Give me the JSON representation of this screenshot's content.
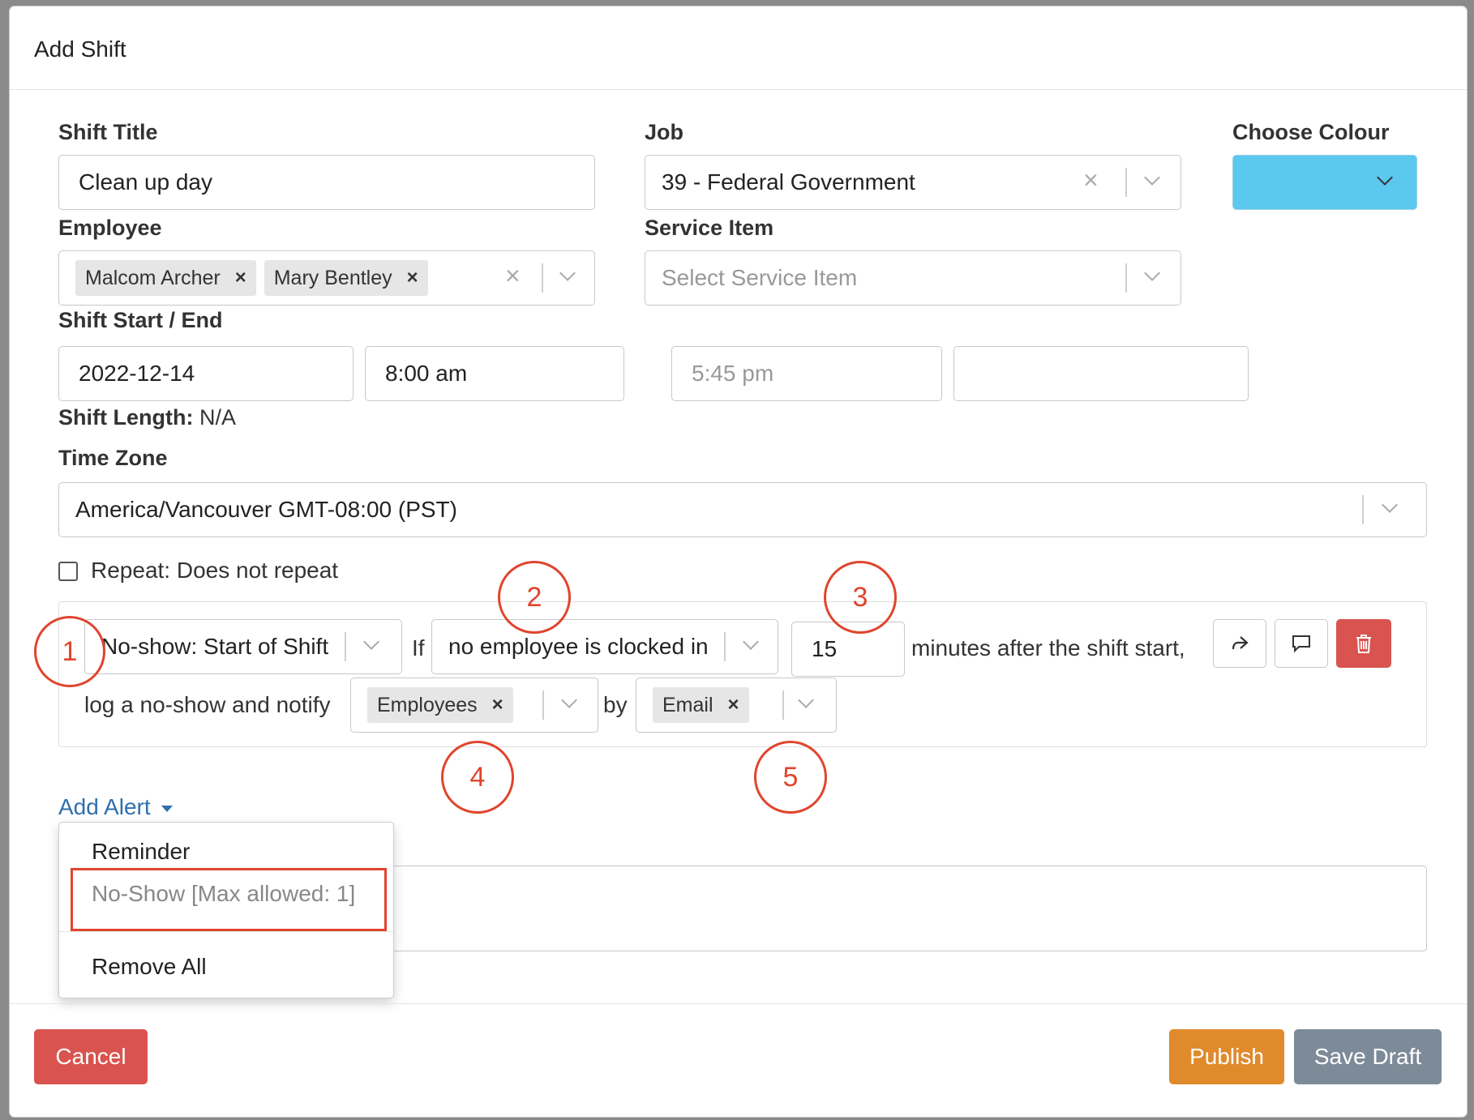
{
  "modal": {
    "title": "Add Shift"
  },
  "form": {
    "shift_title": {
      "label": "Shift Title",
      "value": "Clean up day"
    },
    "job": {
      "label": "Job",
      "value": "39 - Federal Government"
    },
    "colour": {
      "label": "Choose Colour",
      "value": "#5bc8f0"
    },
    "employee": {
      "label": "Employee",
      "tags": [
        "Malcom Archer",
        "Mary Bentley"
      ]
    },
    "service_item": {
      "label": "Service Item",
      "placeholder": "Select Service Item"
    },
    "shift_start_end": {
      "label": "Shift Start / End",
      "start_date": "2022-12-14",
      "start_time": "8:00 am",
      "end_time": "5:45 pm",
      "end_date": ""
    },
    "shift_length": {
      "label": "Shift Length:",
      "value": "N/A"
    },
    "time_zone": {
      "label": "Time Zone",
      "value": "America/Vancouver GMT-08:00 (PST)"
    },
    "repeat": {
      "label": "Repeat: Does not repeat",
      "checked": false
    }
  },
  "alert_rule": {
    "type": "No-show: Start of Shift",
    "if_text": "If",
    "condition": "no employee is clocked in",
    "minutes": "15",
    "after_text": "minutes after the shift start,",
    "log_text": "log a no-show and notify",
    "notify_tags": [
      "Employees"
    ],
    "by_text": "by",
    "method_tags": [
      "Email"
    ]
  },
  "annotations": [
    "1",
    "2",
    "3",
    "4",
    "5"
  ],
  "add_alert": {
    "label": "Add Alert",
    "menu": [
      "Reminder",
      "No-Show [Max allowed: 1]",
      "Remove All"
    ]
  },
  "footer": {
    "cancel": "Cancel",
    "publish": "Publish",
    "save_draft": "Save Draft"
  },
  "colors": {
    "cancel": "#d9534f",
    "publish": "#e08a2c",
    "save_draft": "#7d8b98",
    "delete": "#d9534f",
    "link": "#2f6fad",
    "annotation": "#e0452d"
  }
}
